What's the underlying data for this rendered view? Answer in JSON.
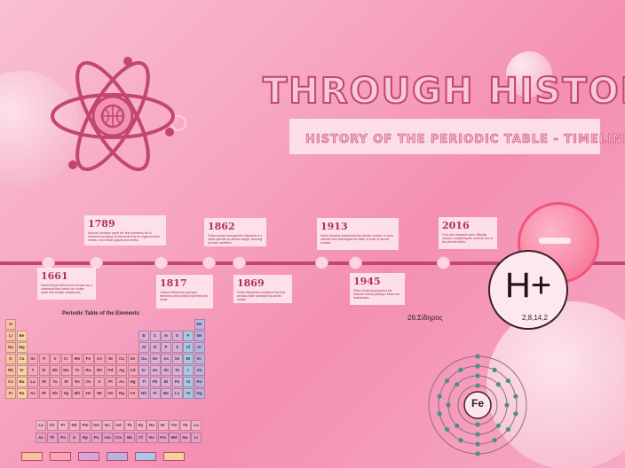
{
  "title": "THROUGH HISTORY",
  "subtitle": "HISTORY OF THE PERIODIC TABLE - TIMELINE",
  "timeline": [
    {
      "year": "1789",
      "desc": "Antoine Lavoisier wrote the first chemistry list of elements including 33 elements that he organized into metals, non-metals, gases and earths."
    },
    {
      "year": "1862",
      "desc": "Chancourtois arranged the elements in a spiral cylinder by atomic weight, showing periodic repetition."
    },
    {
      "year": "1913",
      "desc": "Henry Moseley determined the atomic number of each element and rearranged the table in order of atomic number."
    },
    {
      "year": "2016",
      "desc": "Four new elements were officially named, completing the seventh row of the periodic table."
    },
    {
      "year": "1661",
      "desc": "Robert Boyle defined the element as a substance that cannot be broken down into simpler substances."
    },
    {
      "year": "1817",
      "desc": "Johann Döbereiner grouped elements with similar properties into triads."
    },
    {
      "year": "1869",
      "desc": "Dmitri Mendeleev published the first periodic table arranged by atomic weight."
    },
    {
      "year": "1945",
      "desc": "Glenn Seaborg proposed the actinide series, placing it below the lanthanides."
    }
  ],
  "periodic_table": {
    "title": "Periodic Table of the Elements",
    "lanthanides": [
      "La",
      "Ce",
      "Pr",
      "Nd",
      "Pm",
      "Sm",
      "Eu",
      "Gd",
      "Tb",
      "Dy",
      "Ho",
      "Er",
      "Tm",
      "Yb",
      "Lu"
    ],
    "actinides": [
      "Ac",
      "Th",
      "Pa",
      "U",
      "Np",
      "Pu",
      "Am",
      "Cm",
      "Bk",
      "Cf",
      "Es",
      "Fm",
      "Md",
      "No",
      "Lr"
    ]
  },
  "element_card": {
    "symbol": "H",
    "charge": "+"
  },
  "iron": {
    "label": "26:Σίδηρος",
    "symbol": "Fe",
    "config": "2,8,14,2"
  },
  "colors": {
    "accent": "#c2466f",
    "background": "#f48fb3",
    "card": "#fde6ec"
  },
  "icons": {
    "atom": "atom-icon",
    "basketball": "basketball-icon",
    "minus": "minus-icon",
    "bohr": "bohr-model-icon"
  }
}
